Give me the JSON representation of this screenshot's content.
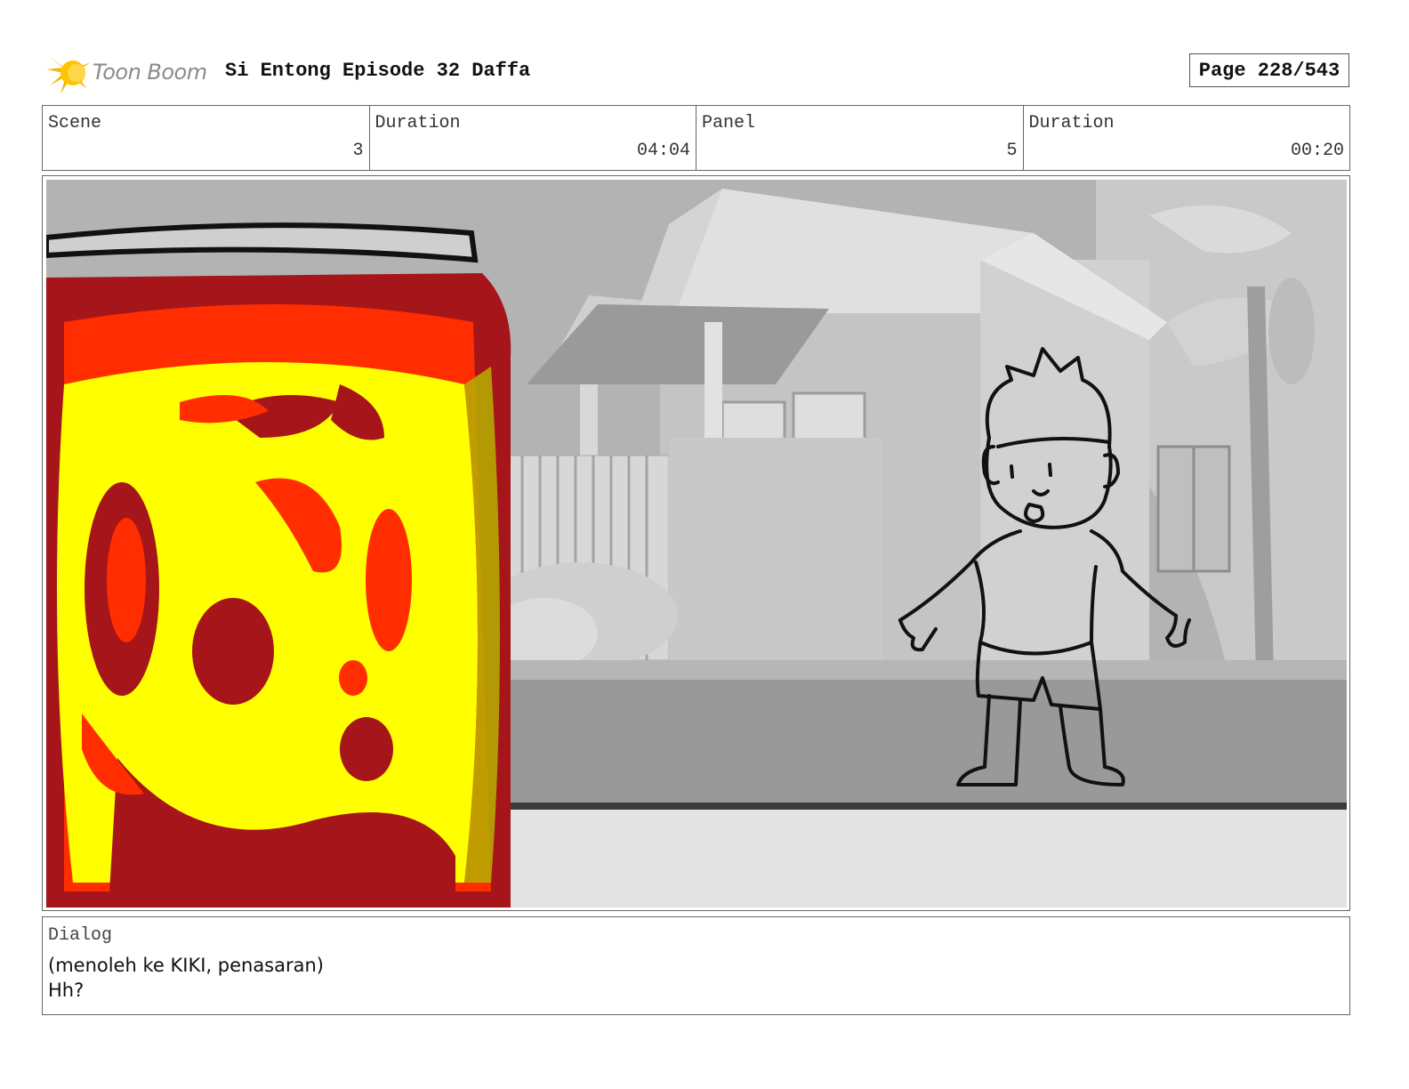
{
  "header": {
    "logo_text": "Toon Boom",
    "title": "Si Entong Episode 32 Daffa",
    "page": "Page 228/543"
  },
  "info": [
    {
      "label": "Scene",
      "value": "3"
    },
    {
      "label": "Duration",
      "value": "04:04"
    },
    {
      "label": "Panel",
      "value": "5"
    },
    {
      "label": "Duration",
      "value": "00:20"
    }
  ],
  "dialog": {
    "label": "Dialog",
    "lines": [
      "(menoleh ke KIKI, penasaran)",
      "Hh?"
    ]
  },
  "colors": {
    "jar_dark": "#a5151a",
    "jar_red": "#ff2d00",
    "jar_yellow": "#ffff00",
    "background_gray": "#bdbdbd"
  }
}
